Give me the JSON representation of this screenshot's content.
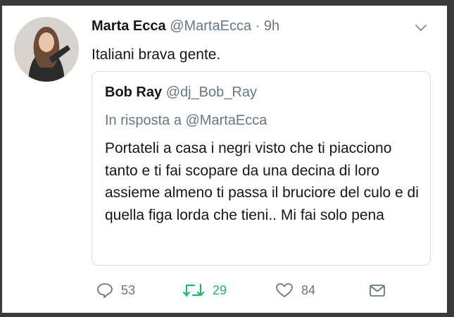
{
  "tweet": {
    "author_name": "Marta Ecca",
    "author_handle": "@MartaEcca",
    "separator": "·",
    "time": "9h",
    "text": "Italiani brava gente."
  },
  "quoted_tweet": {
    "author_name": "Bob Ray",
    "author_handle": "@dj_Bob_Ray",
    "reply_to": "In risposta a @MartaEcca",
    "text": "Portateli a casa i negri visto che ti piacciono tanto e ti fai scopare da una decina di loro assieme almeno ti passa il bruciore del culo e di quella figa lorda che tieni.. Mi fai solo pena"
  },
  "actions": {
    "reply": {
      "icon": "reply-icon",
      "count": "53"
    },
    "retweet": {
      "icon": "retweet-icon",
      "count": "29"
    },
    "like": {
      "icon": "heart-icon",
      "count": "84"
    },
    "message": {
      "icon": "mail-icon"
    }
  },
  "colors": {
    "text": "#14171a",
    "secondary": "#657786",
    "retweet_active": "#17bf63",
    "border": "#d6dee4"
  }
}
